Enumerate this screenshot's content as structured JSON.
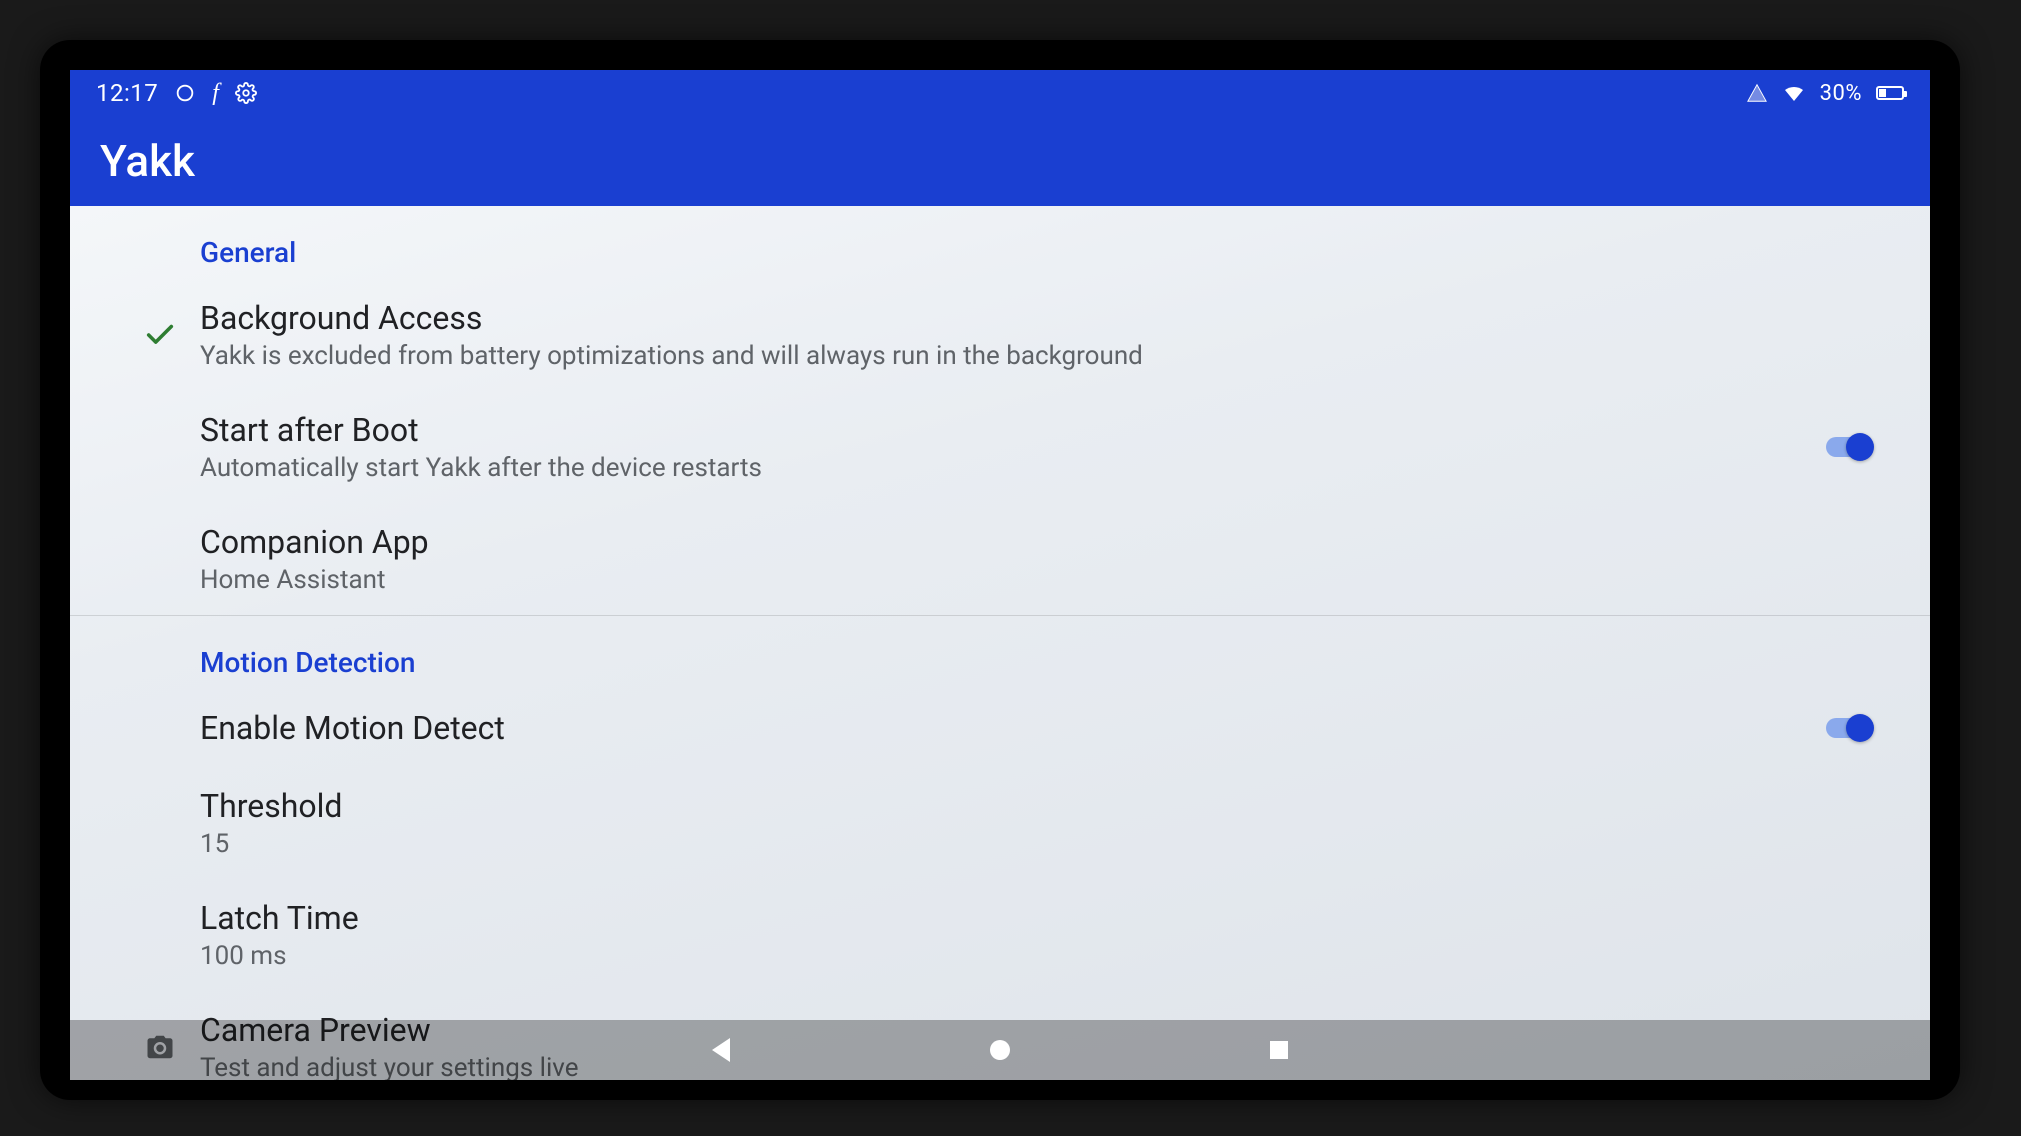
{
  "status": {
    "time": "12:17",
    "battery_text": "30%"
  },
  "app": {
    "title": "Yakk"
  },
  "sections": {
    "general": {
      "header": "General",
      "background_access": {
        "title": "Background Access",
        "sub": "Yakk is excluded from battery optimizations and will always run in the background"
      },
      "start_after_boot": {
        "title": "Start after Boot",
        "sub": "Automatically start Yakk after the device restarts"
      },
      "companion_app": {
        "title": "Companion App",
        "sub": "Home Assistant"
      }
    },
    "motion": {
      "header": "Motion Detection",
      "enable": {
        "title": "Enable Motion Detect"
      },
      "threshold": {
        "title": "Threshold",
        "value": "15"
      },
      "latch_time": {
        "title": "Latch Time",
        "value": "100 ms"
      },
      "camera_preview": {
        "title": "Camera Preview",
        "sub": "Test and adjust your settings live"
      }
    }
  }
}
